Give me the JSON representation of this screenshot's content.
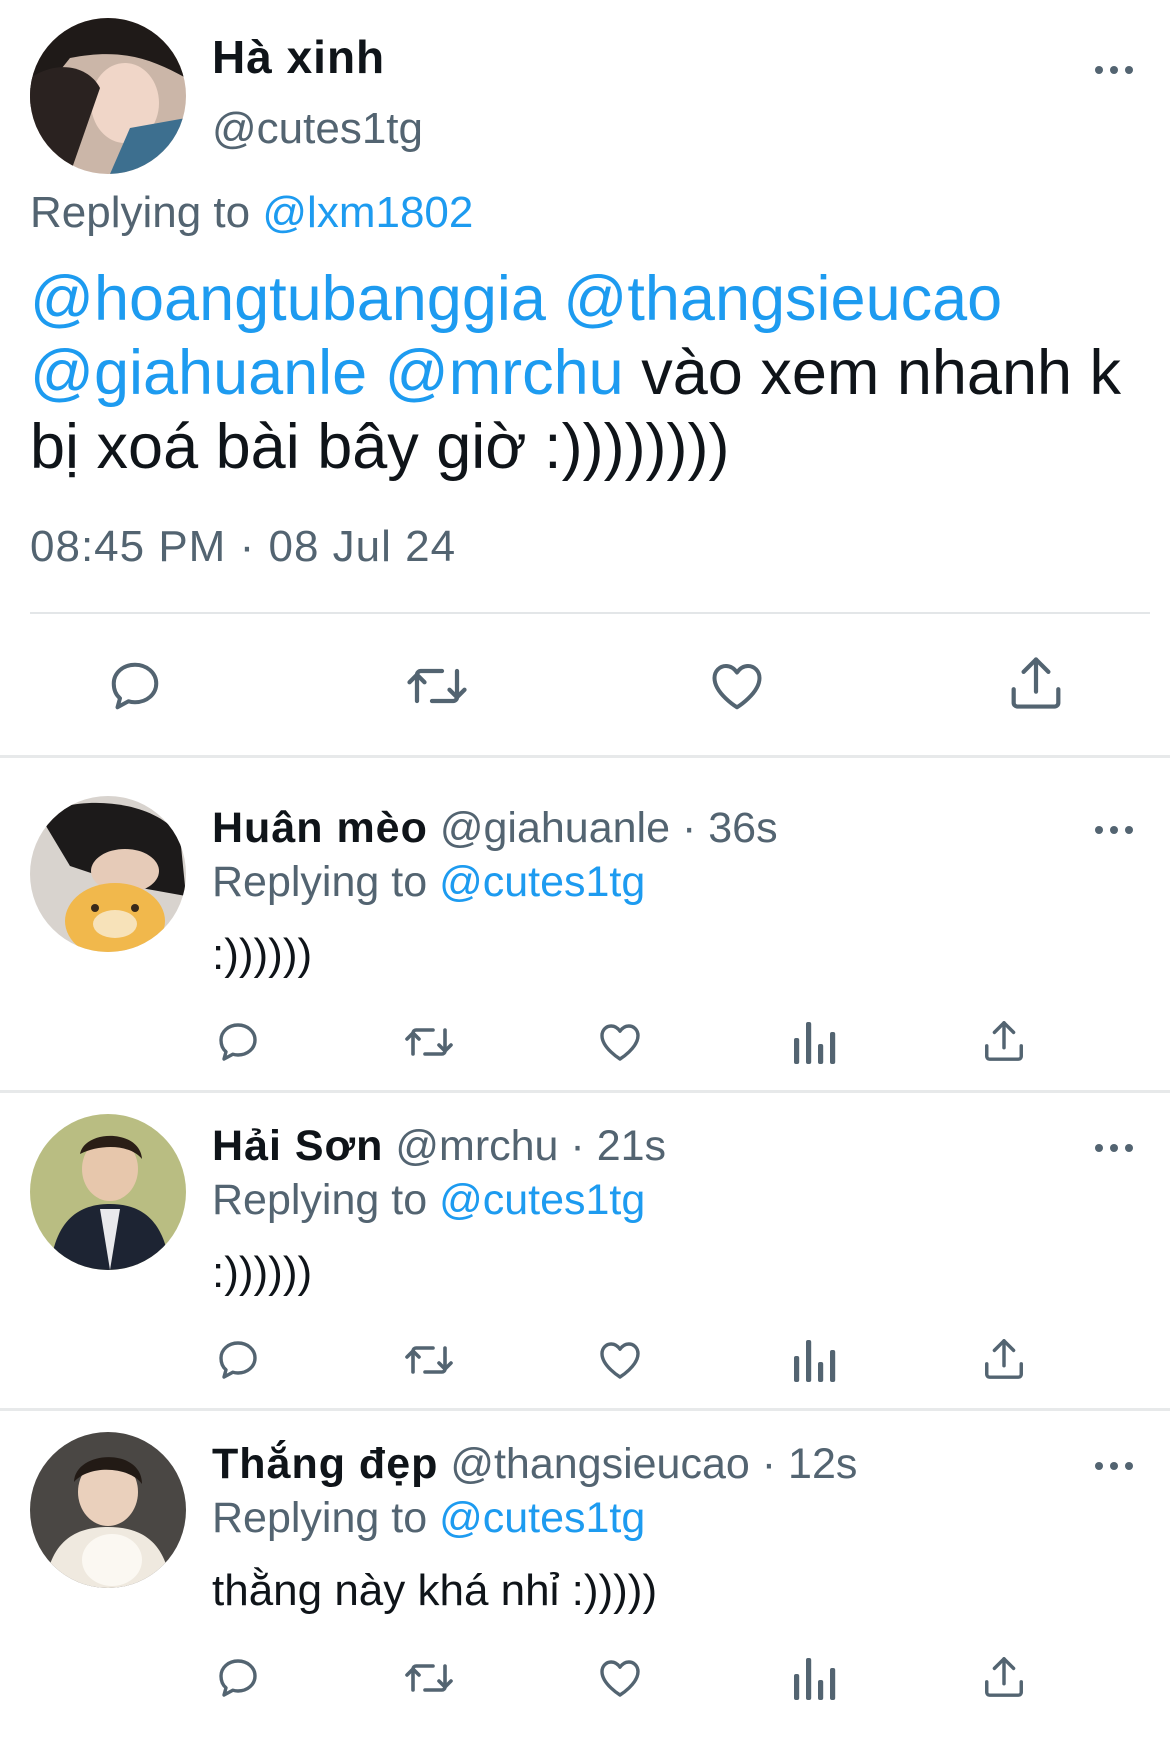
{
  "tweet": {
    "name": "Hà xinh",
    "handle": "@cutes1tg",
    "replying_prefix": "Replying to",
    "replying_to": "@lxm1802",
    "mentions": [
      "@hoangtubanggia",
      "@thangsieucao",
      "@giahuanle",
      "@mrchu"
    ],
    "text": "vào xem nhanh k bị xoá bài bây giờ :))))))))",
    "time": "08:45 PM",
    "date": "08 Jul 24",
    "dot": "·"
  },
  "actions": {
    "icons": [
      "reply-icon",
      "retweet-icon",
      "like-icon",
      "analytics-icon",
      "share-icon"
    ]
  },
  "replies": [
    {
      "name": "Huân mèo",
      "handle": "@giahuanle",
      "time": "36s",
      "replying_prefix": "Replying to",
      "replying_to": "@cutes1tg",
      "text": ":))))))"
    },
    {
      "name": "Hải Sơn",
      "handle": "@mrchu",
      "time": "21s",
      "replying_prefix": "Replying to",
      "replying_to": "@cutes1tg",
      "text": ":))))))"
    },
    {
      "name": "Thắng đẹp",
      "handle": "@thangsieucao",
      "time": "12s",
      "replying_prefix": "Replying to",
      "replying_to": "@cutes1tg",
      "text": "thằng này khá nhỉ :)))))"
    }
  ],
  "colors": {
    "link": "#1d9bf0",
    "secondary": "#536471",
    "text": "#0f1419",
    "divider": "#e7e9ea"
  }
}
